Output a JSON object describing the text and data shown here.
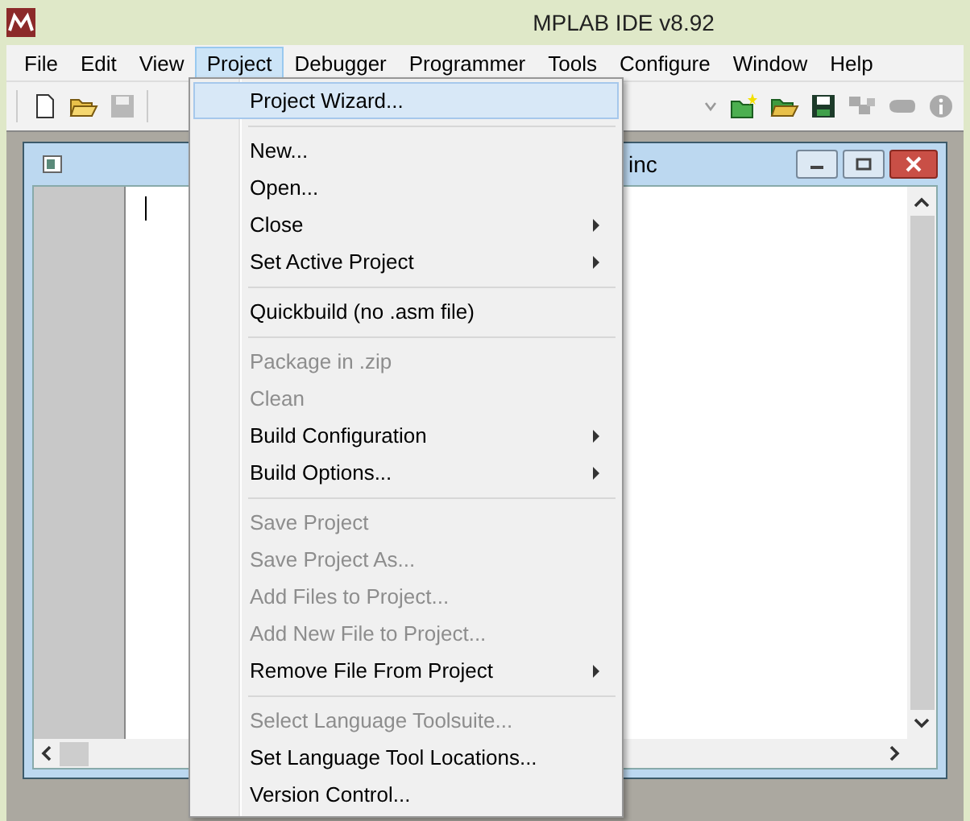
{
  "window": {
    "title": "MPLAB IDE v8.92"
  },
  "menubar": [
    {
      "label": "File",
      "selected": false
    },
    {
      "label": "Edit",
      "selected": false
    },
    {
      "label": "View",
      "selected": false
    },
    {
      "label": "Project",
      "selected": true
    },
    {
      "label": "Debugger",
      "selected": false
    },
    {
      "label": "Programmer",
      "selected": false
    },
    {
      "label": "Tools",
      "selected": false
    },
    {
      "label": "Configure",
      "selected": false
    },
    {
      "label": "Window",
      "selected": false
    },
    {
      "label": "Help",
      "selected": false
    }
  ],
  "toolbar": {
    "save_disabled": true
  },
  "child_window": {
    "title": "inc"
  },
  "project_menu": [
    {
      "kind": "command",
      "label": "Project Wizard...",
      "selected": true,
      "disabled": false,
      "submenu": false
    },
    {
      "kind": "separator"
    },
    {
      "kind": "command",
      "label": "New...",
      "selected": false,
      "disabled": false,
      "submenu": false
    },
    {
      "kind": "command",
      "label": "Open...",
      "selected": false,
      "disabled": false,
      "submenu": false
    },
    {
      "kind": "command",
      "label": "Close",
      "selected": false,
      "disabled": false,
      "submenu": true
    },
    {
      "kind": "command",
      "label": "Set Active Project",
      "selected": false,
      "disabled": false,
      "submenu": true
    },
    {
      "kind": "separator"
    },
    {
      "kind": "command",
      "label": "Quickbuild (no .asm file)",
      "selected": false,
      "disabled": false,
      "submenu": false
    },
    {
      "kind": "separator"
    },
    {
      "kind": "command",
      "label": "Package in .zip",
      "selected": false,
      "disabled": true,
      "submenu": false
    },
    {
      "kind": "command",
      "label": "Clean",
      "selected": false,
      "disabled": true,
      "submenu": false
    },
    {
      "kind": "command",
      "label": "Build Configuration",
      "selected": false,
      "disabled": false,
      "submenu": true
    },
    {
      "kind": "command",
      "label": "Build Options...",
      "selected": false,
      "disabled": false,
      "submenu": true
    },
    {
      "kind": "separator"
    },
    {
      "kind": "command",
      "label": "Save Project",
      "selected": false,
      "disabled": true,
      "submenu": false
    },
    {
      "kind": "command",
      "label": "Save Project As...",
      "selected": false,
      "disabled": true,
      "submenu": false
    },
    {
      "kind": "command",
      "label": "Add Files to Project...",
      "selected": false,
      "disabled": true,
      "submenu": false
    },
    {
      "kind": "command",
      "label": "Add New File to Project...",
      "selected": false,
      "disabled": true,
      "submenu": false
    },
    {
      "kind": "command",
      "label": "Remove File From Project",
      "selected": false,
      "disabled": false,
      "submenu": true
    },
    {
      "kind": "separator"
    },
    {
      "kind": "command",
      "label": "Select Language Toolsuite...",
      "selected": false,
      "disabled": true,
      "submenu": false
    },
    {
      "kind": "command",
      "label": "Set Language Tool Locations...",
      "selected": false,
      "disabled": false,
      "submenu": false
    },
    {
      "kind": "command",
      "label": "Version Control...",
      "selected": false,
      "disabled": false,
      "submenu": false
    }
  ]
}
